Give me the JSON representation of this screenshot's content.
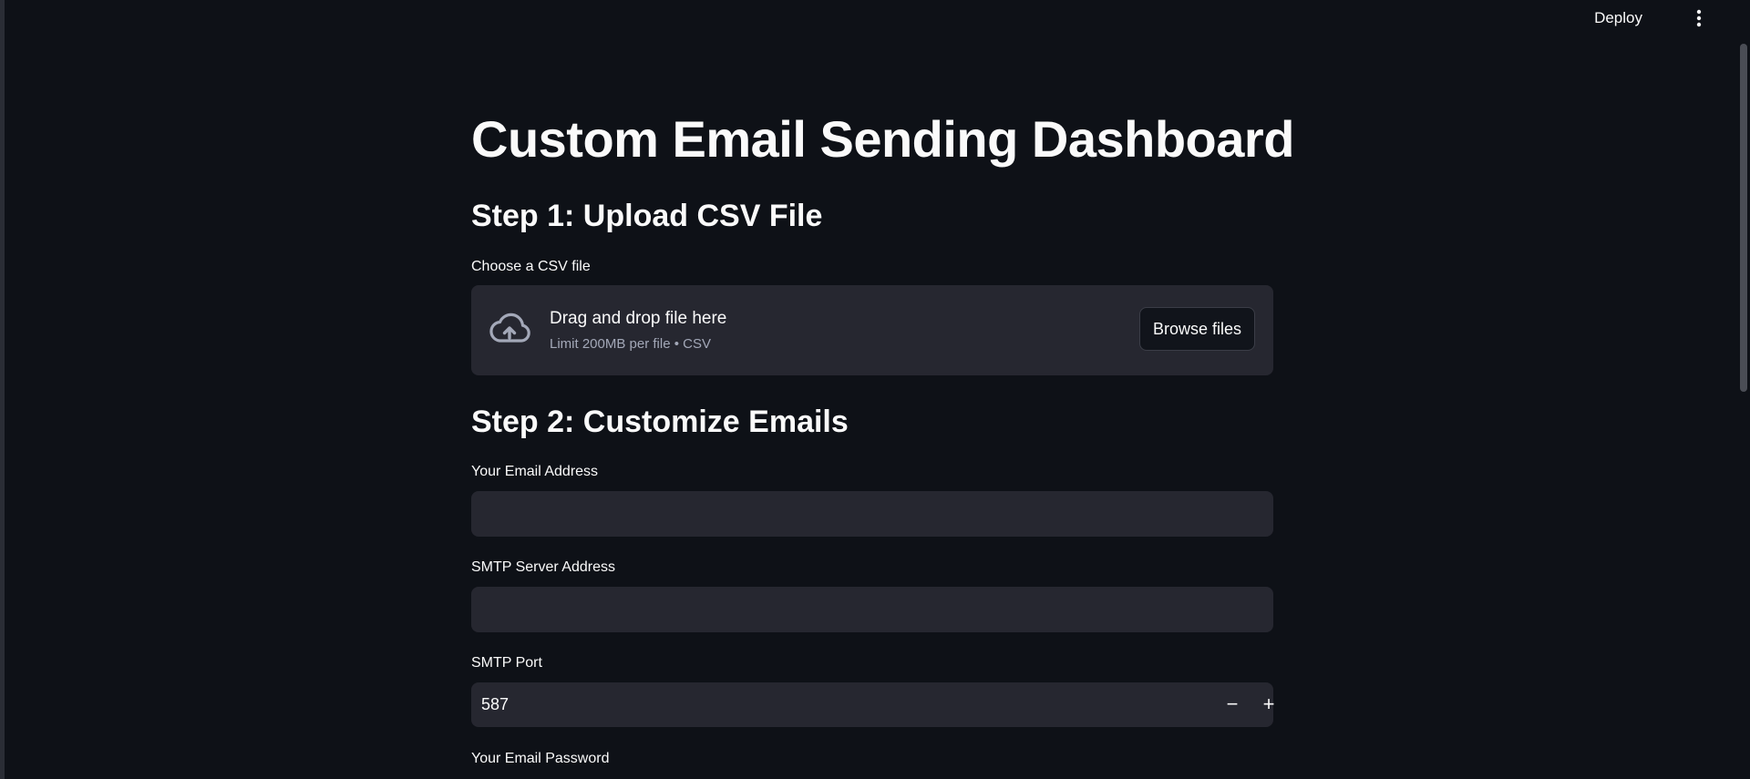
{
  "toolbar": {
    "deploy_label": "Deploy",
    "menu_icon": "kebab-menu-icon"
  },
  "page": {
    "title": "Custom Email Sending Dashboard"
  },
  "step1": {
    "heading": "Step 1: Upload CSV File",
    "uploader_label": "Choose a CSV file",
    "drop_text": "Drag and drop file here",
    "limit_text": "Limit 200MB per file • CSV",
    "browse_label": "Browse files",
    "icon": "cloud-upload-icon"
  },
  "step2": {
    "heading": "Step 2: Customize Emails",
    "email_label": "Your Email Address",
    "email_value": "",
    "smtp_server_label": "SMTP Server Address",
    "smtp_server_value": "",
    "smtp_port_label": "SMTP Port",
    "smtp_port_value": "587",
    "decrement_label": "−",
    "increment_label": "+",
    "password_label": "Your Email Password"
  },
  "colors": {
    "background": "#0e1117",
    "input_background": "#262730",
    "text": "#fafafa",
    "muted_text": "#a3a8b8"
  }
}
